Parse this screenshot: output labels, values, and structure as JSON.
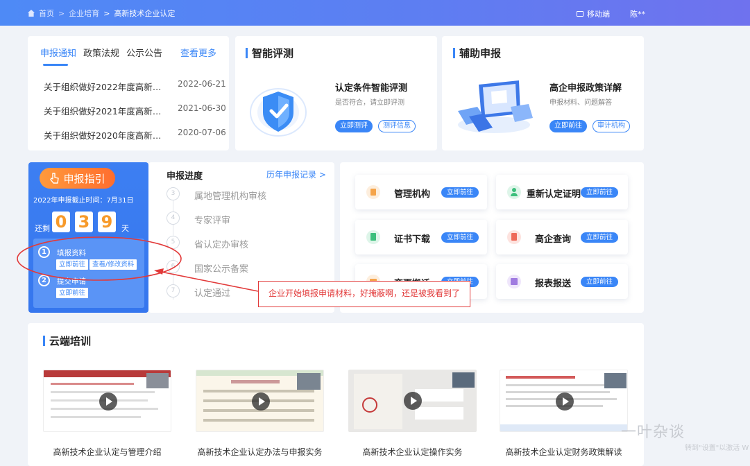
{
  "breadcrumb": {
    "home": "首页",
    "level1": "企业培育",
    "current": "高新技术企业认定"
  },
  "header": {
    "mobile": "移动端",
    "user": "陈**"
  },
  "news": {
    "tabs": [
      "申报通知",
      "政策法规",
      "公示公告"
    ],
    "more": "查看更多",
    "items": [
      {
        "title": "关于组织做好2022年度高新技...",
        "date": "2022-06-21"
      },
      {
        "title": "关于组织做好2021年度高新技...",
        "date": "2021-06-30"
      },
      {
        "title": "关于组织做好2020年度高新技...",
        "date": "2020-07-06"
      }
    ]
  },
  "smart_eval": {
    "title": "智能评测",
    "feature_title": "认定条件智能评测",
    "feature_sub": "是否符合，请立即评测",
    "btn_primary": "立即测评",
    "btn_secondary": "测评信息"
  },
  "assist": {
    "title": "辅助申报",
    "feature_title": "高企申报政策详解",
    "feature_sub": "申报材料、问题解答",
    "btn_primary": "立即前往",
    "btn_secondary": "审计机构"
  },
  "guide": {
    "button": "申报指引",
    "deadline": "2022年申报截止时间：7月31日",
    "remain_prefix": "还剩",
    "digits": [
      "0",
      "3",
      "9"
    ],
    "remain_suffix": "天",
    "steps": [
      {
        "num": "1",
        "label": "填报资料",
        "btn1": "立即前往",
        "btn2": "查看/修改资料"
      },
      {
        "num": "2",
        "label": "提交申请",
        "btn1": "立即前往"
      }
    ]
  },
  "progress": {
    "title": "申报进度",
    "history": "历年申报记录 >",
    "steps": [
      {
        "num": "3",
        "label": "属地管理机构审核"
      },
      {
        "num": "4",
        "label": "专家评审"
      },
      {
        "num": "5",
        "label": "省认定办审核"
      },
      {
        "num": "6",
        "label": "国家公示备案"
      },
      {
        "num": "7",
        "label": "认定通过"
      }
    ]
  },
  "services": [
    {
      "label": "管理机构",
      "btn": "立即前往",
      "color": "#f5a44a"
    },
    {
      "label": "重新认定证明",
      "btn": "立即前往",
      "color": "#3cbf7c"
    },
    {
      "label": "证书下载",
      "btn": "立即前往",
      "color": "#3cbf7c"
    },
    {
      "label": "高企查询",
      "btn": "立即前往",
      "color": "#ee6a5a"
    },
    {
      "label": "变更搬迁",
      "btn": "立即前往",
      "color": "#f5a44a"
    },
    {
      "label": "报表报送",
      "btn": "立即前往",
      "color": "#a07be0"
    }
  ],
  "annotation": {
    "text": "企业开始填报申请材料，好掩蔽啊，还是被我看到了"
  },
  "training": {
    "title": "云端培训",
    "videos": [
      {
        "title": "高新技术企业认定与管理介绍"
      },
      {
        "title": "高新技术企业认定办法与申报实务"
      },
      {
        "title": "高新技术企业认定操作实务"
      },
      {
        "title": "高新技术企业认定财务政策解读"
      }
    ]
  },
  "watermark": {
    "text": "一叶杂谈",
    "sub": "转到\"设置\"以激活 W"
  }
}
